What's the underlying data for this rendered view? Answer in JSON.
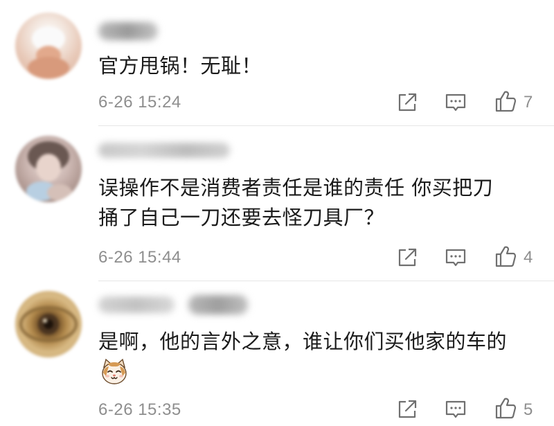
{
  "comments": [
    {
      "username": "",
      "text_lines": [
        "官方甩锅！无耻！"
      ],
      "timestamp": "6-26 15:24",
      "likes": "7",
      "avatar_icon": "user-avatar-icon"
    },
    {
      "username": "",
      "text_lines": [
        "误操作不是消费者责任是谁的责任 你买把刀",
        "捅了自己一刀还要去怪刀具厂？"
      ],
      "timestamp": "6-26 15:44",
      "likes": "4",
      "avatar_icon": "user-avatar-icon"
    },
    {
      "username": "",
      "text_lines": [
        "是啊，他的言外之意，谁让你们买他家的车的"
      ],
      "emoji": "cat-face-emoji",
      "timestamp": "6-26 15:35",
      "likes": "5",
      "avatar_icon": "user-avatar-icon"
    }
  ],
  "icons": {
    "share": "share-icon",
    "comment": "comment-icon",
    "like": "thumbs-up-icon"
  },
  "colors": {
    "text": "#1b1b1b",
    "meta": "#8e8e8e",
    "divider": "#e6e6e6"
  }
}
